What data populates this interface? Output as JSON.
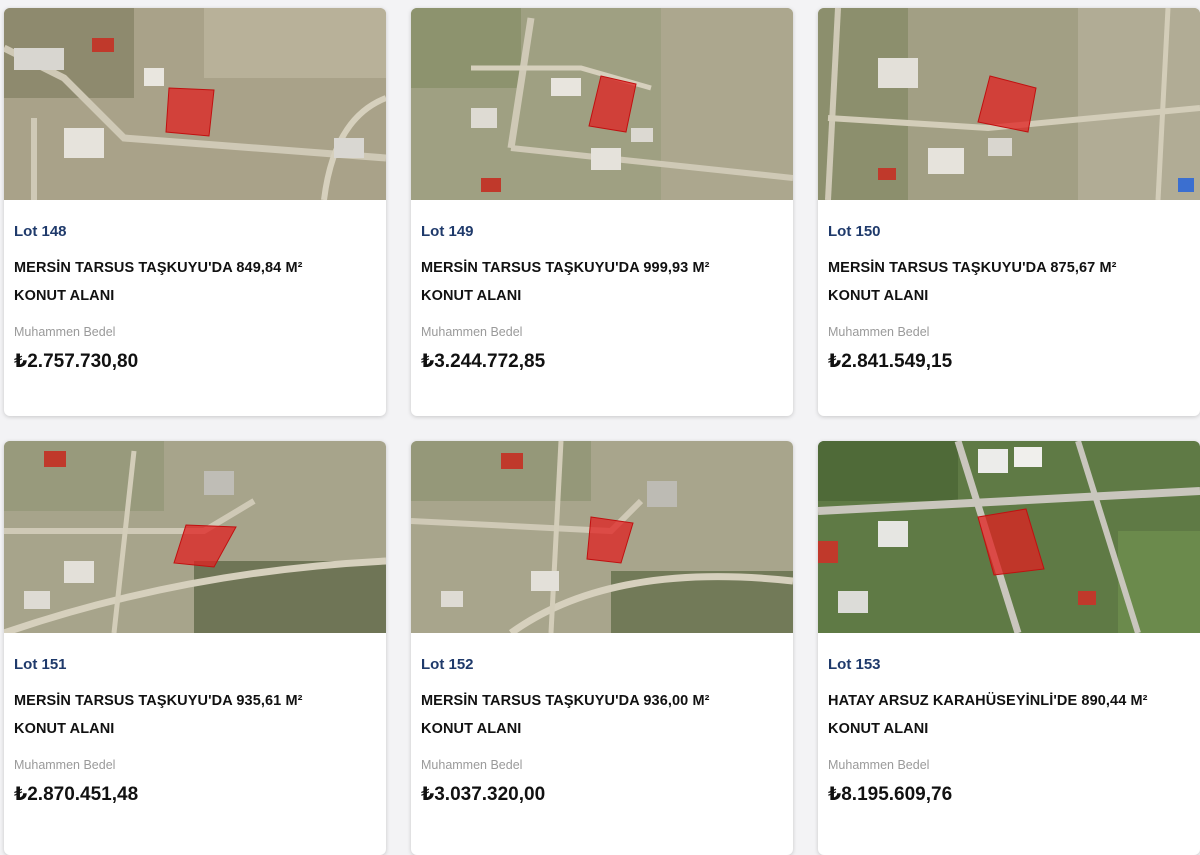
{
  "lots": [
    {
      "lot": "Lot 148",
      "title_line1": "MERSİN TARSUS TAŞKUYU'DA 849,84 M²",
      "title_line2": "KONUT ALANI",
      "bedel_label": "Muhammen Bedel",
      "price": "₺2.757.730,80",
      "map_theme": "arid"
    },
    {
      "lot": "Lot 149",
      "title_line1": "MERSİN TARSUS TAŞKUYU'DA 999,93 M²",
      "title_line2": "KONUT ALANI",
      "bedel_label": "Muhammen Bedel",
      "price": "₺3.244.772,85",
      "map_theme": "arid"
    },
    {
      "lot": "Lot 150",
      "title_line1": "MERSİN TARSUS TAŞKUYU'DA 875,67 M²",
      "title_line2": "KONUT ALANI",
      "bedel_label": "Muhammen Bedel",
      "price": "₺2.841.549,15",
      "map_theme": "arid"
    },
    {
      "lot": "Lot 151",
      "title_line1": "MERSİN TARSUS TAŞKUYU'DA 935,61 M²",
      "title_line2": "KONUT ALANI",
      "bedel_label": "Muhammen Bedel",
      "price": "₺2.870.451,48",
      "map_theme": "arid"
    },
    {
      "lot": "Lot 152",
      "title_line1": "MERSİN TARSUS TAŞKUYU'DA 936,00 M²",
      "title_line2": "KONUT ALANI",
      "bedel_label": "Muhammen Bedel",
      "price": "₺3.037.320,00",
      "map_theme": "arid"
    },
    {
      "lot": "Lot 153",
      "title_line1": "HATAY ARSUZ KARAHÜSEYİNLİ'DE 890,44 M²",
      "title_line2": "KONUT ALANI",
      "bedel_label": "Muhammen Bedel",
      "price": "₺8.195.609,76",
      "map_theme": "green"
    }
  ],
  "colors": {
    "lot_label": "#1f3a6b",
    "parcel_highlight": "#e02020",
    "muted_label": "#9a9a9a",
    "page_bg": "#f3f3f5"
  },
  "icons": [
    "satellite-map-image",
    "parcel-highlight"
  ]
}
